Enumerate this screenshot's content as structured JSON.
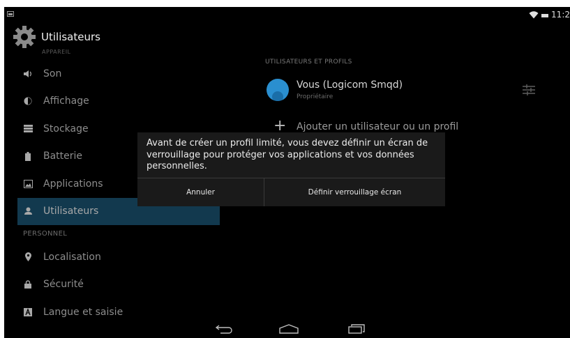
{
  "status_bar": {
    "time": "11:2",
    "notification_icon": "image-notification-icon",
    "wifi_icon": "wifi-icon",
    "battery_icon": "battery-icon"
  },
  "app_bar": {
    "icon": "settings-gear-icon",
    "title": "Utilisateurs",
    "ghost_header": "APPAREIL"
  },
  "sidebar": {
    "items": [
      {
        "label": "Son",
        "icon": "speaker-icon"
      },
      {
        "label": "Affichage",
        "icon": "display-brightness-icon"
      },
      {
        "label": "Stockage",
        "icon": "storage-icon"
      },
      {
        "label": "Batterie",
        "icon": "battery-icon"
      },
      {
        "label": "Applications",
        "icon": "applications-icon"
      },
      {
        "label": "Utilisateurs",
        "icon": "user-icon",
        "active": true
      }
    ],
    "personal_header": "PERSONNEL",
    "personal_items": [
      {
        "label": "Localisation",
        "icon": "location-pin-icon"
      },
      {
        "label": "Sécurité",
        "icon": "lock-icon"
      },
      {
        "label": "Langue et saisie",
        "icon": "keyboard-a-icon"
      }
    ]
  },
  "main": {
    "section_title": "UTILISATEURS ET PROFILS",
    "user": {
      "name": "Vous (Logicom Smqd)",
      "role": "Propriétaire"
    },
    "add_user_label": "Ajouter un utilisateur ou un profil"
  },
  "dialog": {
    "message": "Avant de créer un profil limité, vous devez définir un écran de verrouillage pour protéger vos applications et vos données personnelles.",
    "cancel_label": "Annuler",
    "confirm_label": "Définir verrouillage écran"
  },
  "nav_bar": {
    "back_icon": "back-icon",
    "home_icon": "home-icon",
    "recents_icon": "recents-icon"
  },
  "colors": {
    "background": "#000000",
    "active_item": "#12394e",
    "accent_blue": "#2a8fd0",
    "dialog": "#1a1a1a"
  }
}
